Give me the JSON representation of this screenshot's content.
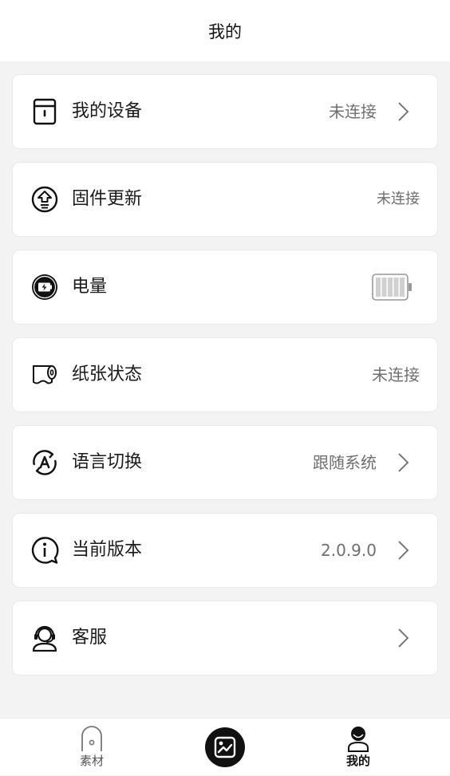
{
  "header": {
    "title": "我的"
  },
  "menu": [
    {
      "label": "我的设备",
      "value": "未连接",
      "icon": "printer-box-icon",
      "chevron": true
    },
    {
      "label": "固件更新",
      "value": "未连接",
      "icon": "firmware-upload-icon",
      "chevron": false
    },
    {
      "label": "电量",
      "value": null,
      "icon": "battery-circle-icon",
      "chevron": false,
      "battery_level": 1.0
    },
    {
      "label": "纸张状态",
      "value": "未连接",
      "icon": "paper-roll-icon",
      "chevron": false
    },
    {
      "label": "语言切换",
      "value": "跟随系统",
      "icon": "language-icon",
      "chevron": true
    },
    {
      "label": "当前版本",
      "value": "2.0.9.0",
      "icon": "info-icon",
      "chevron": true
    },
    {
      "label": "客服",
      "value": "",
      "icon": "customer-service-icon",
      "chevron": true
    }
  ],
  "tabbar": {
    "materials": {
      "label": "素材",
      "icon": "materials-icon"
    },
    "center": {
      "icon": "create-image-icon"
    },
    "mine": {
      "label": "我的",
      "icon": "profile-icon"
    }
  },
  "colors": {
    "accent": "#111111",
    "background": "#f3f3f3",
    "card": "#ffffff",
    "secondary_text": "#6f6f6f"
  }
}
